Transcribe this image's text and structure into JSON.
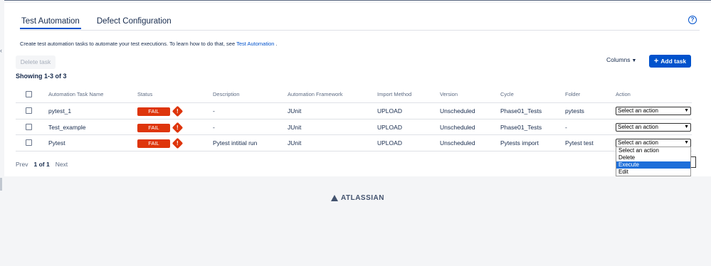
{
  "tabs": [
    {
      "label": "Test Automation",
      "active": true
    },
    {
      "label": "Defect Configuration",
      "active": false
    }
  ],
  "help_icon": "help-circle-icon",
  "info": {
    "text": "Create test automation tasks to automate your test executions. To learn how to do that, see ",
    "link": "Test Automation",
    "suffix": " ."
  },
  "toolbar": {
    "delete_label": "Delete task",
    "columns_label": "Columns",
    "add_label": "Add task"
  },
  "showing": "Showing 1-3 of 3",
  "table": {
    "headers": [
      "Automation Task Name",
      "Status",
      "Description",
      "Automation Framework",
      "Import Method",
      "Version",
      "Cycle",
      "Folder",
      "Action"
    ],
    "rows": [
      {
        "name": "pytest_1",
        "status": "FAIL",
        "description": "-",
        "framework": "JUnit",
        "import_method": "UPLOAD",
        "version": "Unscheduled",
        "cycle": "Phase01_Tests",
        "folder": "pytests",
        "action": "Select an action"
      },
      {
        "name": "Test_example",
        "status": "FAIL",
        "description": "-",
        "framework": "JUnit",
        "import_method": "UPLOAD",
        "version": "Unscheduled",
        "cycle": "Phase01_Tests",
        "folder": "-",
        "action": "Select an action"
      },
      {
        "name": "Pytest",
        "status": "FAIL",
        "description": "Pytest intitial run",
        "framework": "JUnit",
        "import_method": "UPLOAD",
        "version": "Unscheduled",
        "cycle": "Pytests import",
        "folder": "Pytest test",
        "action": "Select an action"
      }
    ]
  },
  "dropdown_options": [
    "Select an action",
    "Delete",
    "Execute",
    "Edit"
  ],
  "dropdown_highlighted": "Execute",
  "pagination": {
    "prev": "Prev",
    "current": "1 of 1",
    "next": "Next"
  },
  "footer": {
    "logo_text": "ATLASSIAN"
  },
  "colors": {
    "accent": "#0052cc",
    "fail": "#de350b",
    "highlight": "#1e6fd9"
  }
}
